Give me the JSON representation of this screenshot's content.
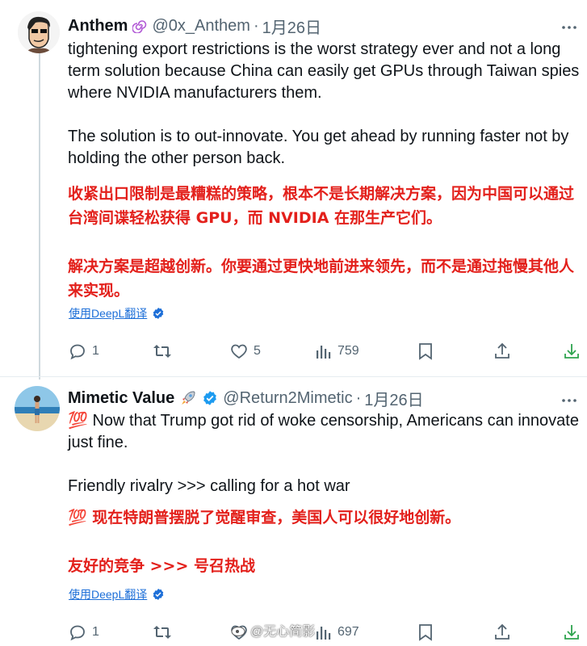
{
  "tweets": [
    {
      "name": "Anthem",
      "handle": "@0x_Anthem",
      "separator": "·",
      "date": "1月26日",
      "text": "tightening export restrictions is the worst strategy ever and not a long term solution because China can easily get GPUs through Taiwan spies where NVIDIA manufacturers them.\n\nThe solution is to out-innovate. You get ahead by running faster not by holding the other person back.",
      "translation": "收紧出口限制是最糟糕的策略，根本不是长期解决方案，因为中国可以通过台湾间谍轻松获得 GPU，而 NVIDIA 在那生产它们。\n\n解决方案是超越创新。你要通过更快地前进来领先，而不是通过拖慢其他人来实现。",
      "translate_link": "使用DeepL翻译",
      "replies": "1",
      "retweets": "",
      "likes": "5",
      "views": "759"
    },
    {
      "name": "Mimetic Value",
      "handle": "@Return2Mimetic",
      "separator": "·",
      "date": "1月26日",
      "emoji_prefix": "💯",
      "text": " Now that Trump got rid of woke censorship, Americans can innovate just fine.\n\nFriendly rivalry >>> calling for a hot war",
      "translation": "💯 现在特朗普摆脱了觉醒审查，美国人可以很好地创新。\n\n友好的竞争 >>> 号召热战",
      "translate_link": "使用DeepL翻译",
      "replies": "1",
      "retweets": "",
      "likes": "",
      "views": "697"
    }
  ],
  "watermark": "@无心简影",
  "colors": {
    "translation": "#e3201b",
    "link": "#1d6fd8",
    "verified": "#1d9bf0",
    "muted": "#536471",
    "download": "#2ea44f"
  },
  "icons": [
    "more-icon",
    "reply-icon",
    "retweet-icon",
    "like-icon",
    "views-icon",
    "bookmark-icon",
    "share-icon",
    "download-icon",
    "verified-icon",
    "rocket-icon",
    "spiral-icon"
  ]
}
